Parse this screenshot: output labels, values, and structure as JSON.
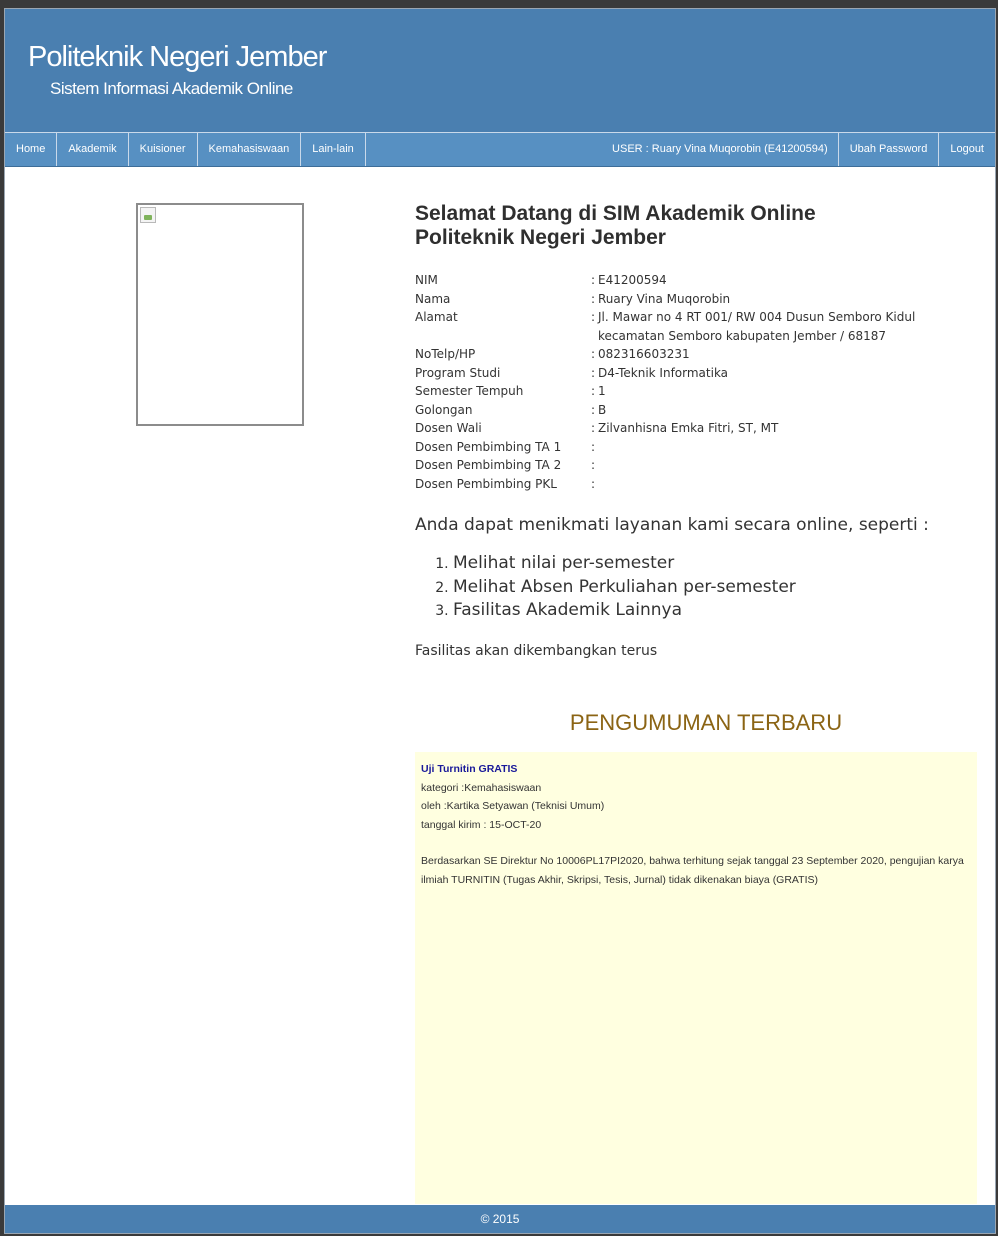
{
  "header": {
    "title": "Politeknik Negeri Jember",
    "subtitle": "Sistem Informasi Akademik Online"
  },
  "nav": {
    "items": [
      "Home",
      "Akademik",
      "Kuisioner",
      "Kemahasiswaan",
      "Lain-lain"
    ],
    "user": "USER : Ruary Vina Muqorobin (E41200594)",
    "change_password": "Ubah Password",
    "logout": "Logout"
  },
  "welcome": {
    "title_line1": "Selamat Datang di SIM Akademik Online",
    "title_line2": "Politeknik Negeri Jember"
  },
  "student": {
    "separator": ":",
    "rows": [
      {
        "label": "NIM",
        "value": "E41200594"
      },
      {
        "label": "Nama",
        "value": "Ruary Vina Muqorobin"
      },
      {
        "label": "Alamat",
        "value": "Jl. Mawar no 4 RT 001/ RW 004 Dusun Semboro Kidul kecamatan Semboro kabupaten Jember / 68187"
      },
      {
        "label": "NoTelp/HP",
        "value": "082316603231"
      },
      {
        "label": "Program Studi",
        "value": "D4-Teknik Informatika"
      },
      {
        "label": "Semester Tempuh",
        "value": "1"
      },
      {
        "label": "Golongan",
        "value": "B"
      },
      {
        "label": "Dosen Wali",
        "value": "Zilvanhisna Emka Fitri, ST, MT"
      },
      {
        "label": "Dosen Pembimbing TA 1",
        "value": ""
      },
      {
        "label": "Dosen Pembimbing TA 2",
        "value": ""
      },
      {
        "label": "Dosen Pembimbing PKL",
        "value": ""
      }
    ]
  },
  "services": {
    "intro": "Anda dapat menikmati layanan kami secara online, seperti :",
    "items": [
      "Melihat nilai per-semester",
      "Melihat Absen Perkuliahan per-semester",
      "Fasilitas Akademik Lainnya"
    ],
    "note": "Fasilitas akan dikembangkan terus"
  },
  "announcement": {
    "heading": "PENGUMUMAN TERBARU",
    "title": "Uji Turnitin GRATIS",
    "category": "kategori :Kemahasiswaan",
    "author": "oleh :Kartika Setyawan (Teknisi Umum)",
    "date": "tanggal kirim : 15-OCT-20",
    "body": "Berdasarkan SE Direktur No 10006PL17PI2020, bahwa terhitung sejak tanggal 23 September 2020, pengujian karya ilmiah TURNITIN (Tugas Akhir, Skripsi, Tesis, Jurnal) tidak dikenakan biaya (GRATIS)"
  },
  "footer": {
    "text": "© 2015"
  }
}
